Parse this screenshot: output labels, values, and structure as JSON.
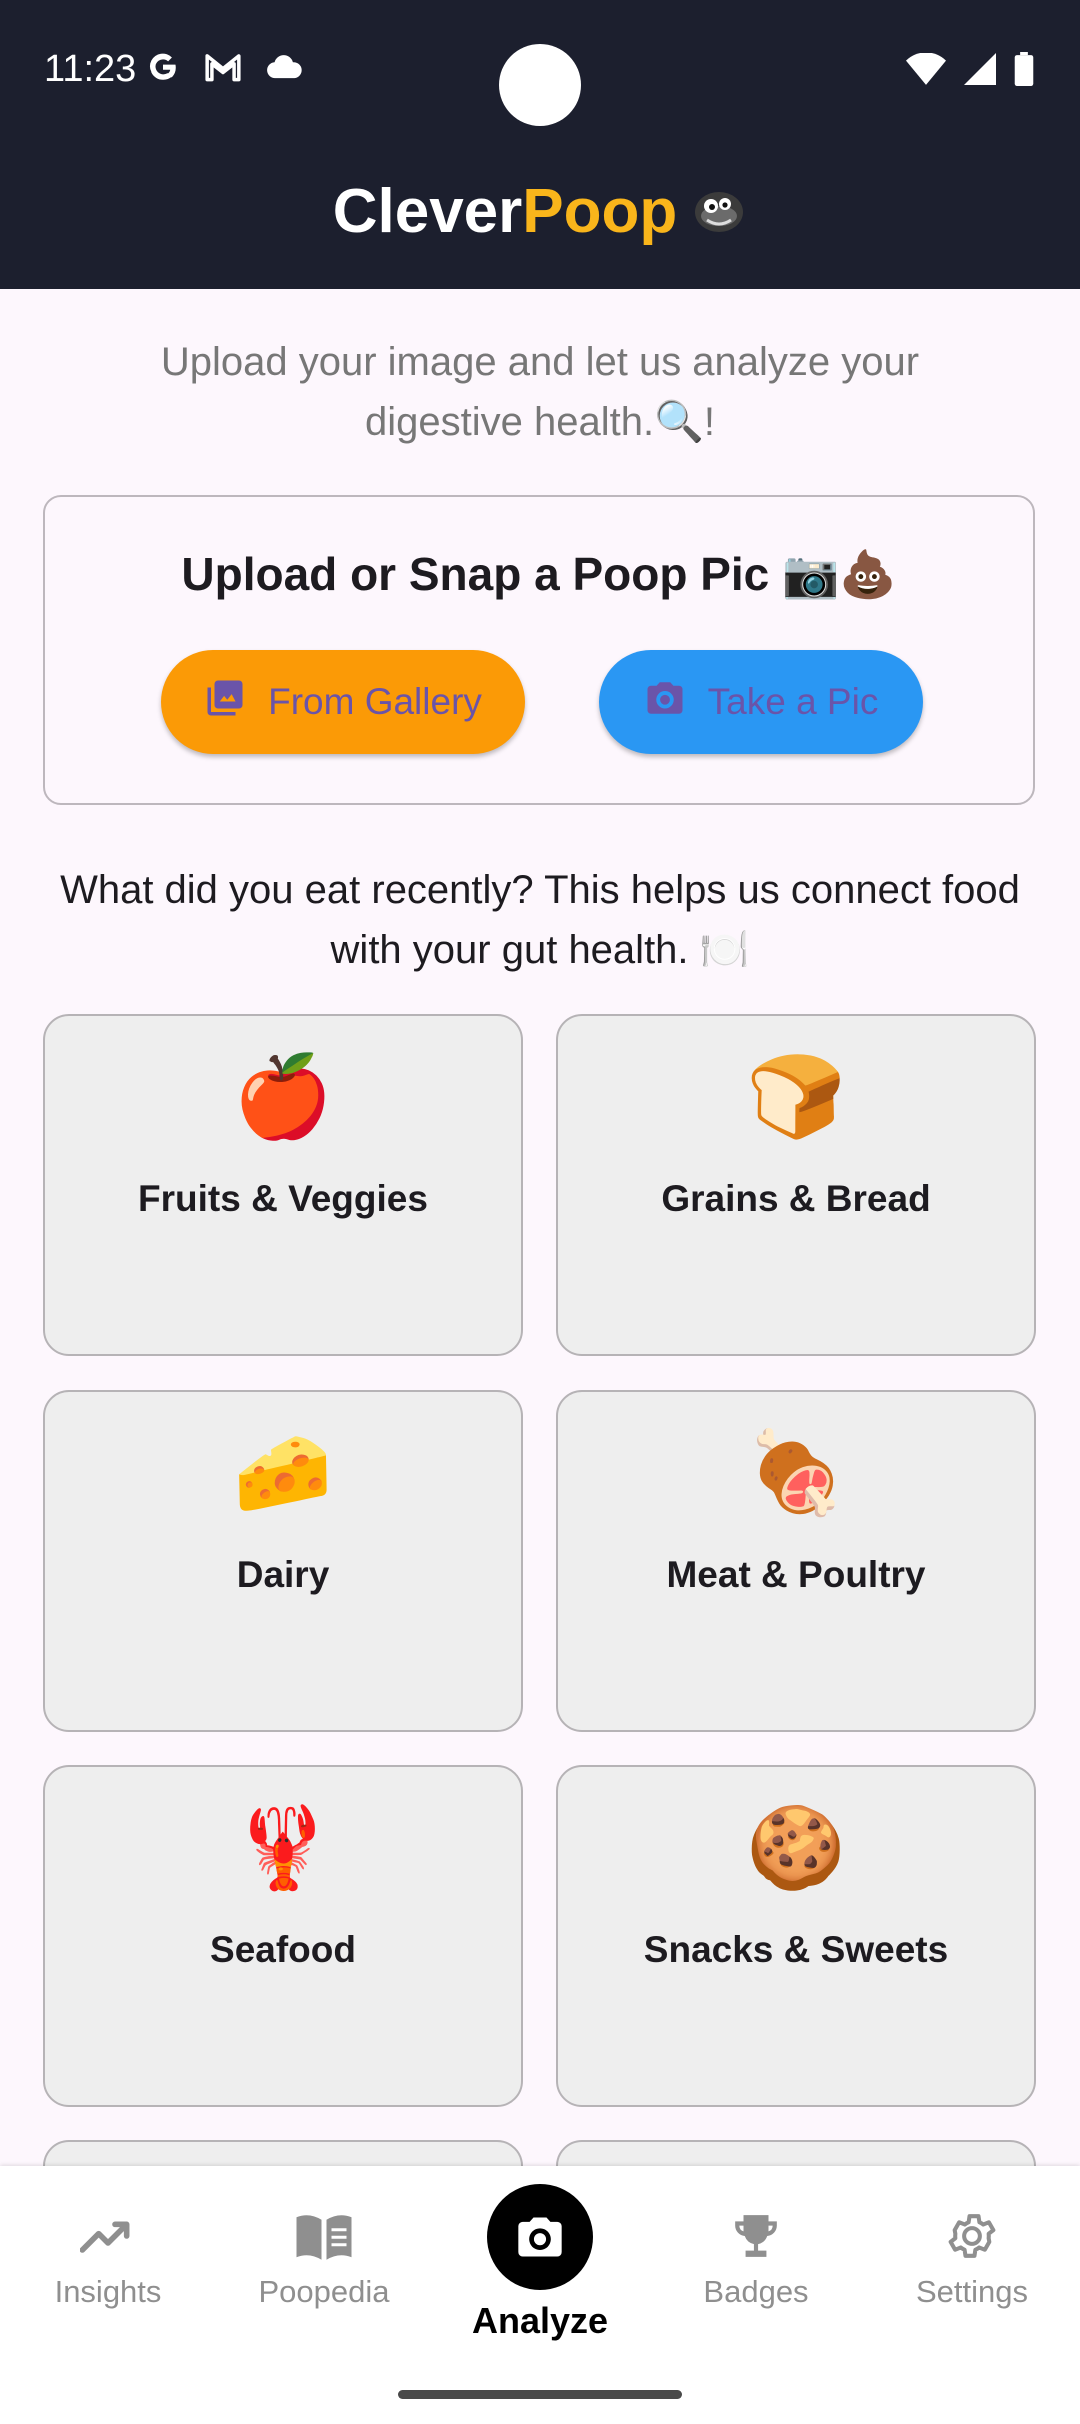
{
  "status_bar": {
    "time": "11:23"
  },
  "header": {
    "title_part1": "Clever",
    "title_part2": "Poop"
  },
  "subtitle": "Upload your image and let us analyze your digestive health.🔍!",
  "upload": {
    "title": "Upload or Snap a Poop Pic 📷💩",
    "gallery_label": "From Gallery",
    "take_label": "Take a Pic"
  },
  "question": "What did you eat recently? This helps us connect food with your gut health. 🍽️",
  "food_categories": [
    {
      "emoji": "🍎",
      "label": "Fruits & Veggies"
    },
    {
      "emoji": "🍞",
      "label": "Grains & Bread"
    },
    {
      "emoji": "🧀",
      "label": "Dairy"
    },
    {
      "emoji": "🍖",
      "label": "Meat & Poultry"
    },
    {
      "emoji": "🦞",
      "label": "Seafood"
    },
    {
      "emoji": "🍪",
      "label": "Snacks & Sweets"
    }
  ],
  "nav": {
    "insights": "Insights",
    "poopedia": "Poopedia",
    "analyze": "Analyze",
    "badges": "Badges",
    "settings": "Settings"
  },
  "colors": {
    "header_bg": "#1c1f2e",
    "brand_yellow": "#f9b51b",
    "gallery_orange": "#fb9a06",
    "take_blue": "#2a97f3",
    "button_text": "#6a54a9"
  },
  "icons": {
    "status": [
      "google-g-icon",
      "gmail-icon",
      "cloud-icon",
      "wifi-icon",
      "signal-icon",
      "battery-icon"
    ],
    "nav": [
      "trending-up-icon",
      "book-icon",
      "camera-icon",
      "trophy-icon",
      "gear-icon"
    ]
  }
}
